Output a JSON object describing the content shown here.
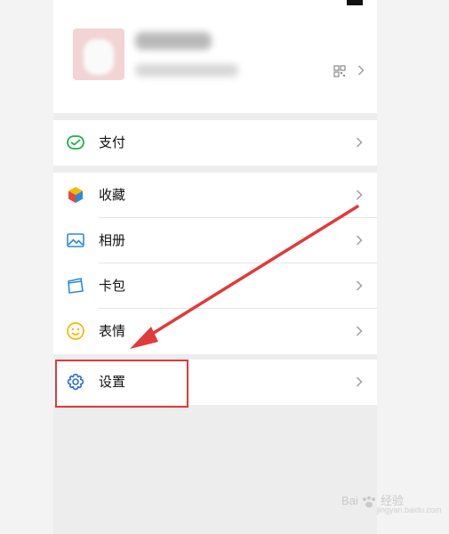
{
  "profile": {},
  "menu": {
    "pay": {
      "label": "支付",
      "icon": "wallet-icon",
      "color": "#20b04b"
    },
    "favorites": {
      "label": "收藏",
      "icon": "cube-icon"
    },
    "album": {
      "label": "相册",
      "icon": "picture-icon",
      "color": "#2b8ad8"
    },
    "cards": {
      "label": "卡包",
      "icon": "card-icon",
      "color": "#2b8ad8"
    },
    "stickers": {
      "label": "表情",
      "icon": "smiley-icon",
      "color": "#f5b800"
    },
    "settings": {
      "label": "设置",
      "icon": "gear-icon",
      "color": "#2b6fd6"
    }
  },
  "annotation": {
    "color": "#e03a3a"
  },
  "watermark": {
    "brand": "Bai",
    "brand2": "经验",
    "url": "jingyan.baidu.com"
  }
}
